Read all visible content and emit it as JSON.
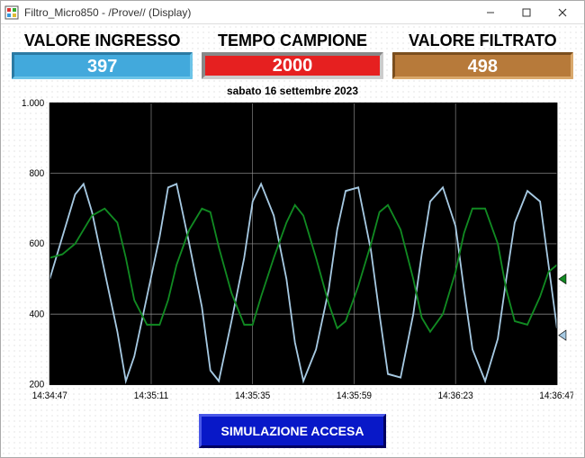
{
  "window": {
    "title": "Filtro_Micro850 - /Prove// (Display)"
  },
  "panels": {
    "ingresso": {
      "label": "VALORE INGRESSO",
      "value": "397"
    },
    "tempo": {
      "label": "TEMPO CAMPIONE",
      "value": "2000"
    },
    "filtrato": {
      "label": "VALORE FILTRATO",
      "value": "498"
    }
  },
  "date_text": "sabato 16 settembre 2023",
  "sim_button": "SIMULAZIONE ACCESA",
  "chart_data": {
    "type": "line",
    "xlabel": "",
    "ylabel": "",
    "ylim": [
      200,
      1000
    ],
    "y_ticks": [
      200,
      400,
      600,
      800,
      1000
    ],
    "y_tick_labels": [
      "200",
      "400",
      "600",
      "800",
      "1.000"
    ],
    "x_ticks": [
      0,
      24,
      48,
      72,
      96,
      120
    ],
    "x_tick_labels": [
      "14:34:47",
      "14:35:11",
      "14:35:35",
      "14:35:59",
      "14:36:23",
      "14:36:47"
    ],
    "series": [
      {
        "name": "ingresso",
        "color": "#a6c9e2",
        "values": [
          [
            0,
            500
          ],
          [
            3,
            620
          ],
          [
            6,
            740
          ],
          [
            8,
            770
          ],
          [
            10,
            690
          ],
          [
            13,
            520
          ],
          [
            16,
            350
          ],
          [
            18,
            210
          ],
          [
            20,
            280
          ],
          [
            23,
            450
          ],
          [
            26,
            620
          ],
          [
            28,
            760
          ],
          [
            30,
            770
          ],
          [
            33,
            600
          ],
          [
            36,
            420
          ],
          [
            38,
            240
          ],
          [
            40,
            210
          ],
          [
            43,
            380
          ],
          [
            46,
            560
          ],
          [
            48,
            720
          ],
          [
            50,
            770
          ],
          [
            53,
            680
          ],
          [
            56,
            500
          ],
          [
            58,
            320
          ],
          [
            60,
            210
          ],
          [
            63,
            300
          ],
          [
            66,
            470
          ],
          [
            68,
            640
          ],
          [
            70,
            750
          ],
          [
            73,
            760
          ],
          [
            76,
            580
          ],
          [
            78,
            400
          ],
          [
            80,
            230
          ],
          [
            83,
            220
          ],
          [
            86,
            400
          ],
          [
            88,
            570
          ],
          [
            90,
            720
          ],
          [
            93,
            760
          ],
          [
            96,
            650
          ],
          [
            98,
            470
          ],
          [
            100,
            300
          ],
          [
            103,
            210
          ],
          [
            106,
            330
          ],
          [
            108,
            500
          ],
          [
            110,
            660
          ],
          [
            113,
            750
          ],
          [
            116,
            720
          ],
          [
            118,
            540
          ],
          [
            120,
            360
          ]
        ],
        "marker_end": 340
      },
      {
        "name": "filtrato",
        "color": "#118a22",
        "values": [
          [
            0,
            560
          ],
          [
            3,
            570
          ],
          [
            6,
            600
          ],
          [
            8,
            640
          ],
          [
            10,
            680
          ],
          [
            13,
            700
          ],
          [
            16,
            660
          ],
          [
            18,
            560
          ],
          [
            20,
            440
          ],
          [
            23,
            370
          ],
          [
            26,
            370
          ],
          [
            28,
            440
          ],
          [
            30,
            540
          ],
          [
            33,
            640
          ],
          [
            36,
            700
          ],
          [
            38,
            690
          ],
          [
            40,
            590
          ],
          [
            43,
            460
          ],
          [
            46,
            370
          ],
          [
            48,
            370
          ],
          [
            50,
            450
          ],
          [
            53,
            560
          ],
          [
            56,
            660
          ],
          [
            58,
            710
          ],
          [
            60,
            680
          ],
          [
            63,
            560
          ],
          [
            66,
            430
          ],
          [
            68,
            360
          ],
          [
            70,
            380
          ],
          [
            73,
            480
          ],
          [
            76,
            600
          ],
          [
            78,
            690
          ],
          [
            80,
            710
          ],
          [
            83,
            640
          ],
          [
            86,
            500
          ],
          [
            88,
            390
          ],
          [
            90,
            350
          ],
          [
            93,
            400
          ],
          [
            96,
            520
          ],
          [
            98,
            630
          ],
          [
            100,
            700
          ],
          [
            103,
            700
          ],
          [
            106,
            600
          ],
          [
            108,
            470
          ],
          [
            110,
            380
          ],
          [
            113,
            370
          ],
          [
            116,
            450
          ],
          [
            118,
            520
          ],
          [
            120,
            540
          ]
        ],
        "marker_end": 500
      }
    ]
  }
}
